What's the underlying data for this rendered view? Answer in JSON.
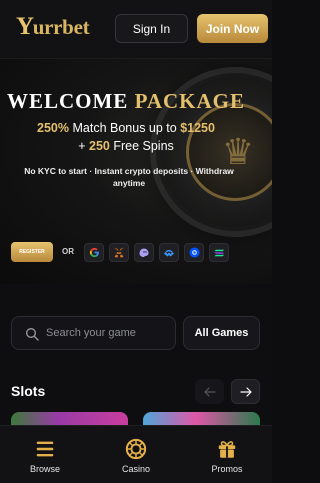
{
  "header": {
    "logo_text": "urrbet",
    "logo_initial": "Y",
    "signin_label": "Sign In",
    "join_label": "Join Now"
  },
  "banner": {
    "title_white": "WELCOME",
    "title_gold": "PACKAGE",
    "line1_pct": "250%",
    "line1_text": "Match Bonus up to",
    "line1_amount": "$1250",
    "line2_plus": "+",
    "line2_num": "250",
    "line2_text": "Free Spins",
    "subtext": "No KYC to start · Instant crypto deposits · Withdraw anytime",
    "register_label": "REGISTER",
    "or_label": "OR",
    "social_icons": [
      "google-icon",
      "metamask-icon",
      "phantom-icon",
      "walletconnect-icon",
      "coinbase-icon",
      "solana-icon"
    ]
  },
  "search": {
    "placeholder": "Search your game",
    "all_games_label": "All Games"
  },
  "slots": {
    "title": "Slots",
    "prev_icon": "arrow-left-icon",
    "next_icon": "arrow-right-icon"
  },
  "bottom_nav": {
    "items": [
      {
        "label": "Browse",
        "icon": "menu-icon"
      },
      {
        "label": "Casino",
        "icon": "casino-chip-icon"
      },
      {
        "label": "Promos",
        "icon": "gift-icon"
      }
    ]
  },
  "colors": {
    "gold": "#e4c06d",
    "background": "#0e0e10",
    "panel": "#141418"
  }
}
